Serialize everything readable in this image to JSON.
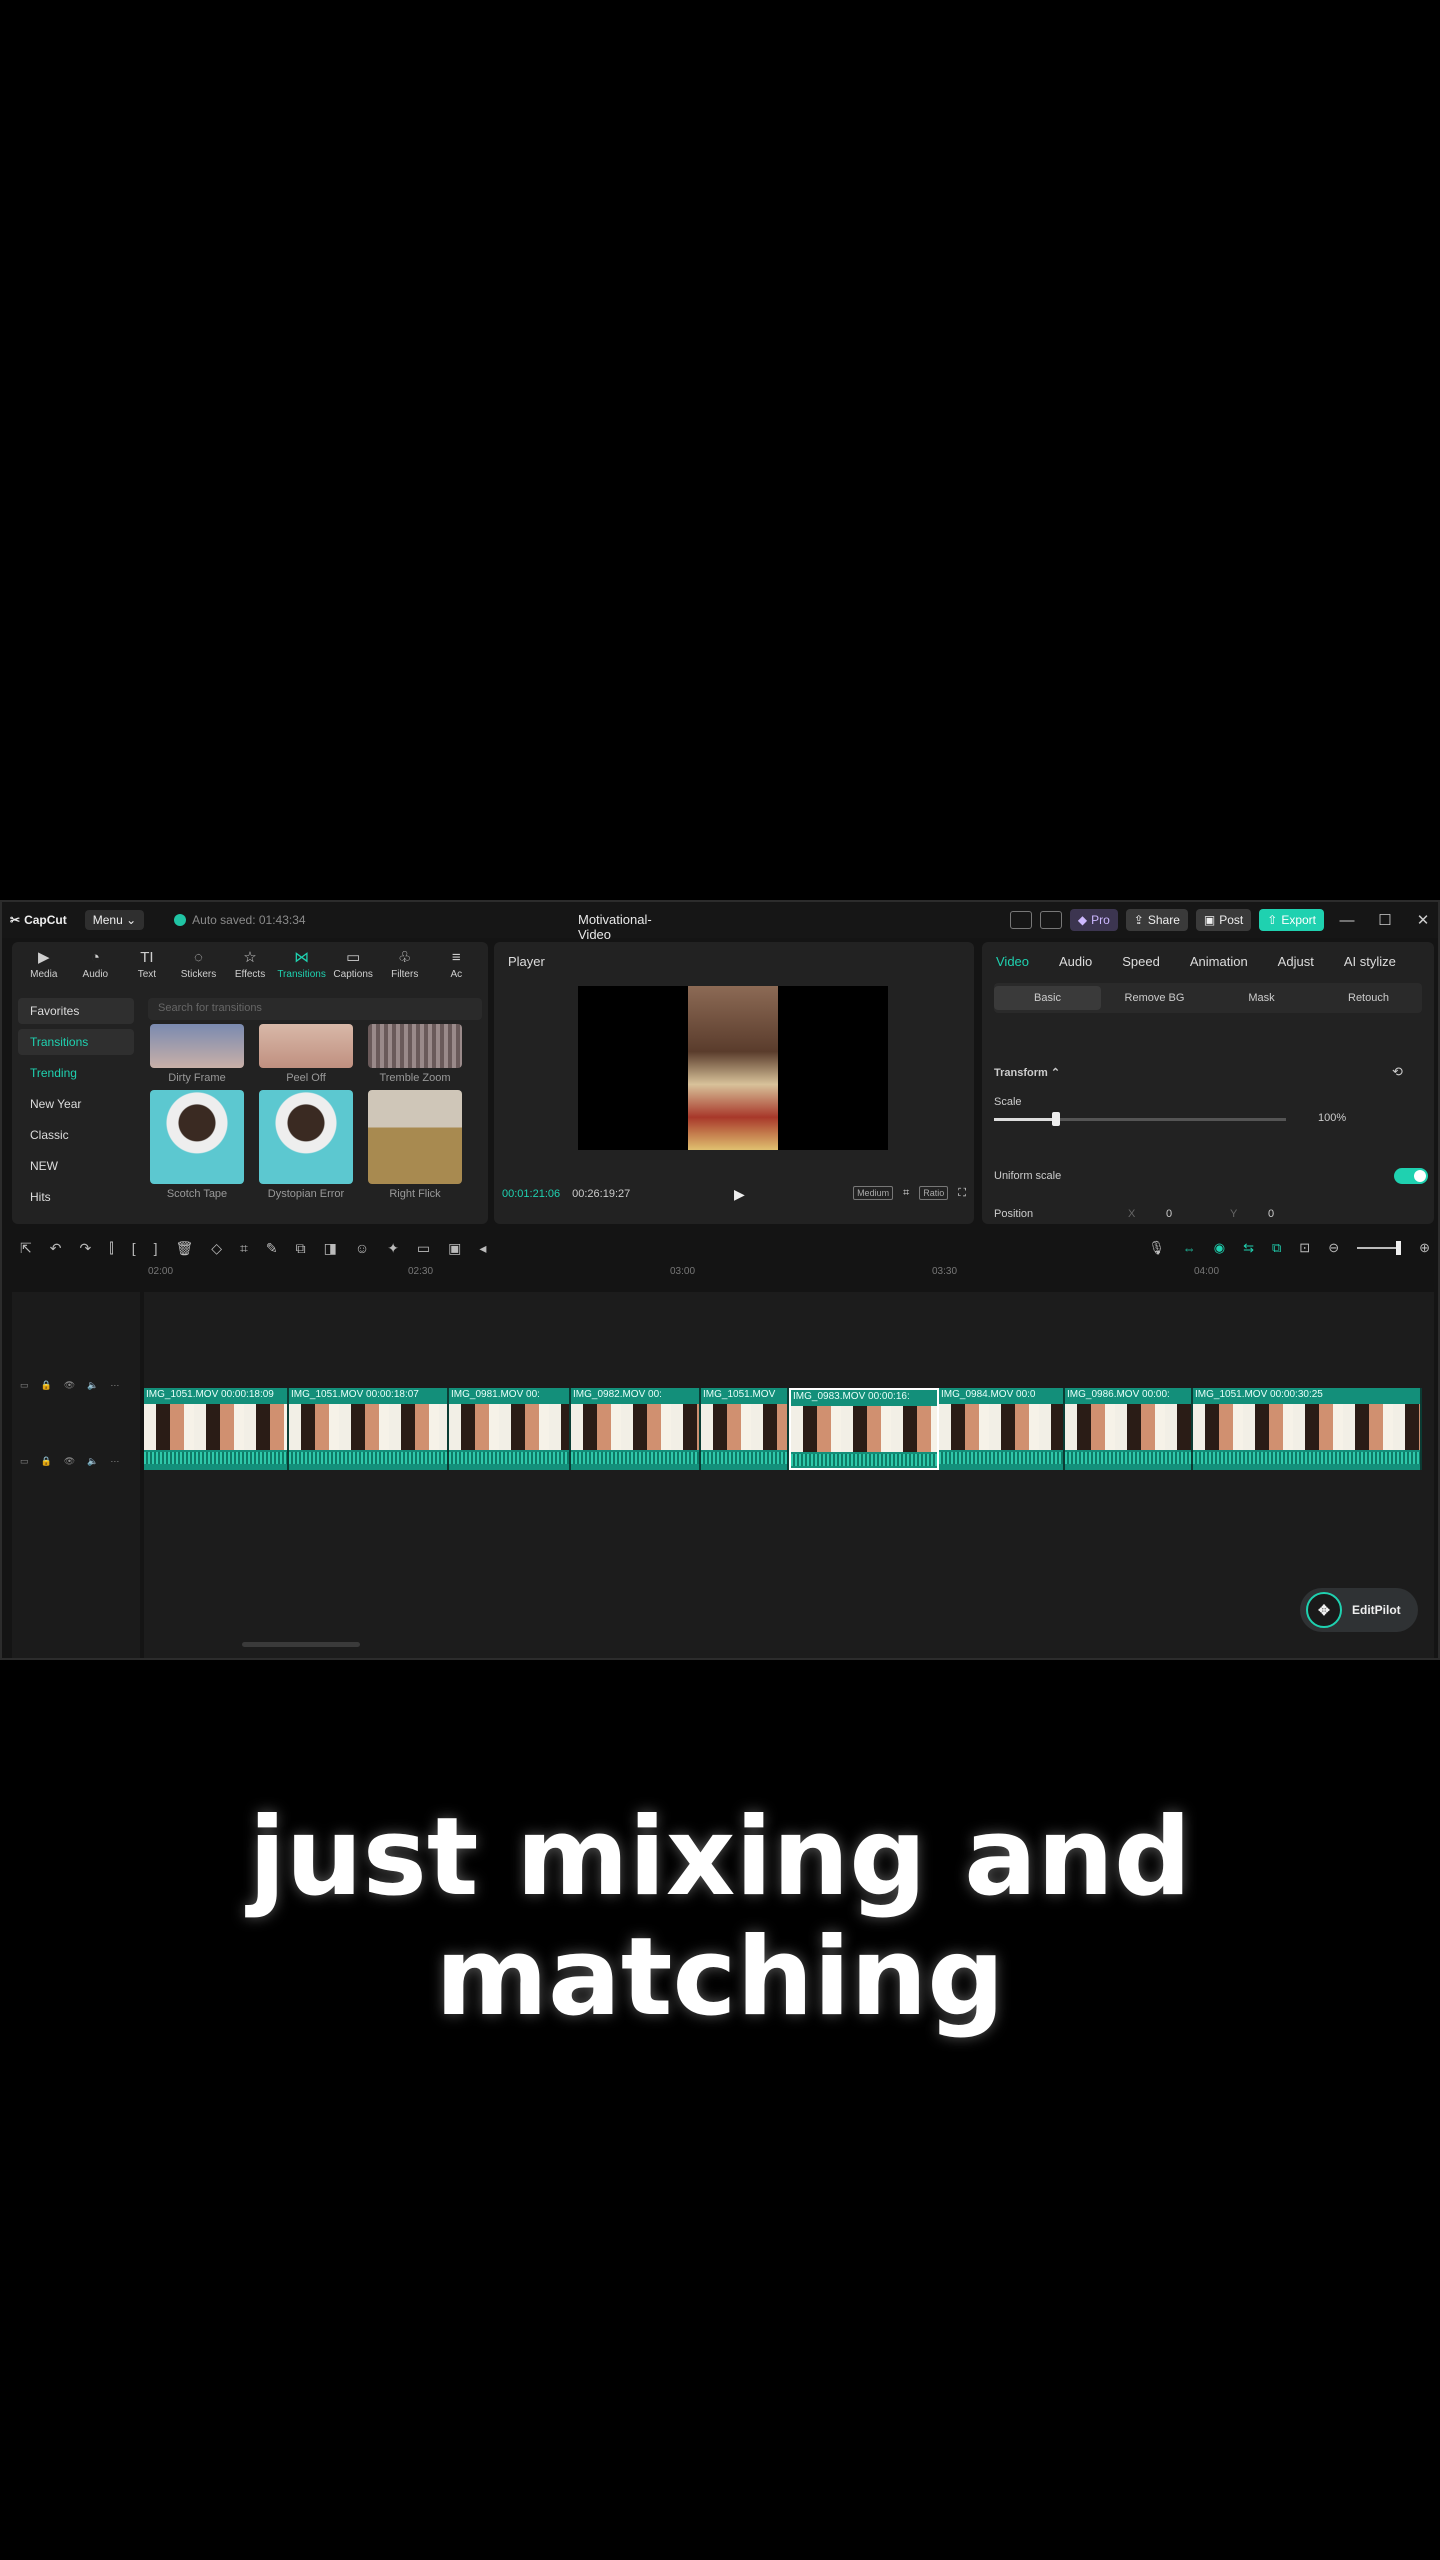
{
  "app": {
    "logo": "CapCut",
    "menu": "Menu",
    "autosave": "Auto saved: 01:43:34",
    "project_title": "Motivational-Video",
    "pro": "Pro",
    "share": "Share",
    "post": "Post",
    "export": "Export"
  },
  "media_tabs": [
    {
      "label": "Media",
      "icon": "media-icon"
    },
    {
      "label": "Audio",
      "icon": "audio-icon"
    },
    {
      "label": "Text",
      "icon": "text-icon"
    },
    {
      "label": "Stickers",
      "icon": "stickers-icon"
    },
    {
      "label": "Effects",
      "icon": "effects-icon"
    },
    {
      "label": "Transitions",
      "icon": "transitions-icon"
    },
    {
      "label": "Captions",
      "icon": "captions-icon"
    },
    {
      "label": "Filters",
      "icon": "filters-icon"
    },
    {
      "label": "Ac",
      "icon": "adjust-icon"
    }
  ],
  "side_categories": [
    "Favorites",
    "Transitions",
    "Trending",
    "New Year",
    "Classic",
    "NEW",
    "Hits"
  ],
  "search_placeholder": "Search for transitions",
  "thumbs": [
    "Dirty Frame",
    "Peel Off",
    "Tremble Zoom",
    "Scotch Tape",
    "Dystopian Error",
    "Right Flick"
  ],
  "player": {
    "title": "Player",
    "current": "00:01:21:06",
    "total": "00:26:19:27",
    "quality": "Medium",
    "ratio": "Ratio"
  },
  "props": {
    "tabs": [
      "Video",
      "Audio",
      "Speed",
      "Animation",
      "Adjust",
      "AI stylize"
    ],
    "subtabs": [
      "Basic",
      "Remove BG",
      "Mask",
      "Retouch"
    ],
    "transform": "Transform",
    "scale_label": "Scale",
    "scale_value": "100%",
    "uniform_label": "Uniform scale",
    "position_label": "Position",
    "x_label": "X",
    "x_value": "0",
    "y_label": "Y",
    "y_value": "0"
  },
  "ruler": [
    "02:00",
    "02:30",
    "03:00",
    "03:30",
    "04:00"
  ],
  "clips": [
    "IMG_1051.MOV  00:00:18:09",
    "IMG_1051.MOV  00:00:18:07",
    "IMG_0981.MOV  00:",
    "IMG_0982.MOV  00:",
    "IMG_1051.MOV",
    "IMG_0983.MOV  00:00:16:",
    "IMG_0984.MOV  00:0",
    "IMG_0986.MOV  00:00:",
    "IMG_1051.MOV  00:00:30:25"
  ],
  "editpilot": "EditPilot",
  "caption_line1": "just mixing and",
  "caption_line2": "matching",
  "accent_color": "#1fd1b0"
}
